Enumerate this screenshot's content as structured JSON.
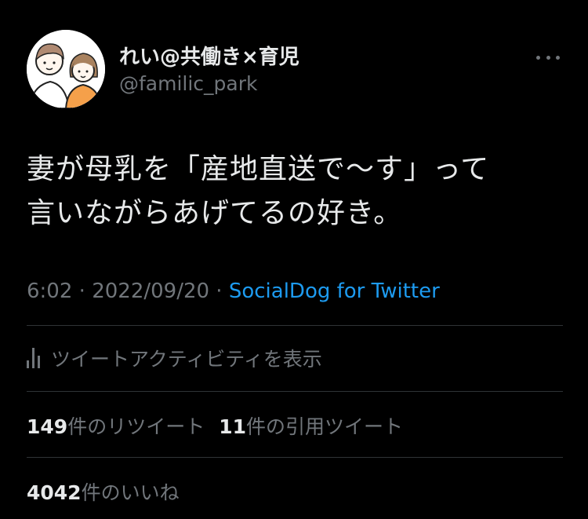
{
  "author": {
    "display_name": "れい@共働き×育児",
    "handle": "@familic_park"
  },
  "tweet": {
    "text_line1": "妻が母乳を「産地直送で〜す」って",
    "text_line2": "言いながらあげてるの好き。"
  },
  "meta": {
    "time": "6:02",
    "separator": " · ",
    "date": "2022/09/20",
    "source": "SocialDog for Twitter"
  },
  "activity": {
    "label": "ツイートアクティビティを表示"
  },
  "stats": {
    "retweets_count": "149",
    "retweets_label": "件のリツイート",
    "quotes_count": "11",
    "quotes_label": "件の引用ツイート",
    "likes_count": "4042",
    "likes_label": "件のいいね"
  },
  "colors": {
    "background": "#000000",
    "text": "#e7e9ea",
    "secondary": "#71767b",
    "link": "#1d9bf0",
    "divider": "#2f3336"
  }
}
